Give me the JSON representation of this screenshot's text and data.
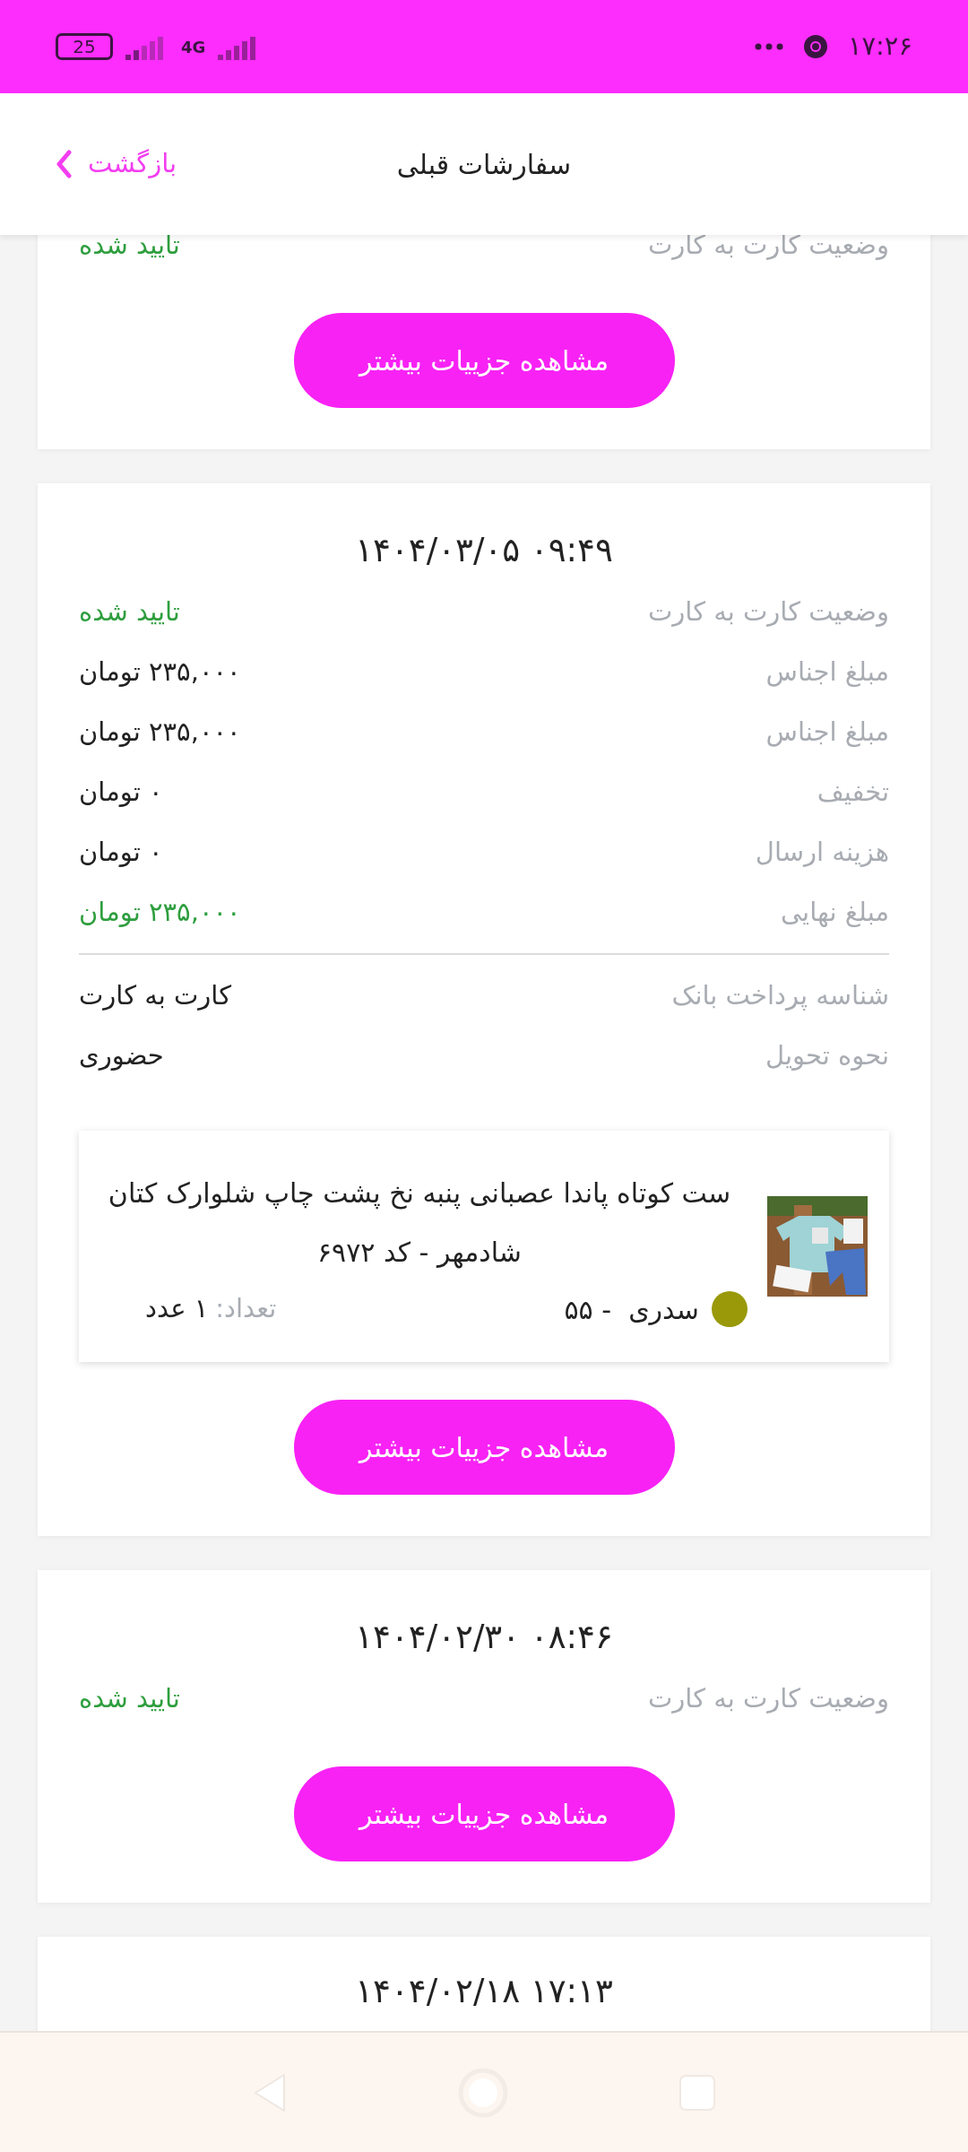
{
  "status_bar": {
    "battery": "25",
    "network": "4G",
    "time": "۱۷:۲۶"
  },
  "header": {
    "title": "سفارشات قبلی",
    "back_label": "بازگشت"
  },
  "orders": [
    {
      "rows": [
        {
          "label": "وضعیت کارت به کارت",
          "value": "تایید شده",
          "highlighted": true
        }
      ],
      "button": "مشاهده جزییات بیشتر"
    },
    {
      "datetime": "۱۴۰۴/۰۳/۰۵ ۰۹:۴۹",
      "rows": [
        {
          "label": "وضعیت کارت به کارت",
          "value": "تایید شده",
          "highlighted": true
        },
        {
          "label": "مبلغ اجناس",
          "value": "۲۳۵,۰۰۰ تومان",
          "highlighted": false
        },
        {
          "label": "مبلغ اجناس",
          "value": "۲۳۵,۰۰۰ تومان",
          "highlighted": false
        },
        {
          "label": "تخفیف",
          "value": "۰ تومان",
          "highlighted": false
        },
        {
          "label": "هزینه ارسال",
          "value": "۰ تومان",
          "highlighted": false
        },
        {
          "label": "مبلغ نهایی",
          "value": "۲۳۵,۰۰۰ تومان",
          "highlighted": true
        }
      ],
      "details": [
        {
          "label": "شناسه پرداخت بانک",
          "value": "کارت به کارت",
          "highlighted": false
        },
        {
          "label": "نحوه تحویل",
          "value": "حضوری",
          "highlighted": false
        }
      ],
      "product": {
        "title": "ست کوتاه پاندا عصبانی پنبه نخ پشت چاپ شلوارک کتان شادمهر - کد ۶۹۷۲",
        "color": "#99990a",
        "variant": "سدری  - ۵۵",
        "quantity_label": "تعداد:",
        "quantity": "۱ عدد"
      },
      "button": "مشاهده جزییات بیشتر"
    },
    {
      "datetime": "۱۴۰۴/۰۲/۳۰ ۰۸:۴۶",
      "rows": [
        {
          "label": "وضعیت کارت به کارت",
          "value": "تایید شده",
          "highlighted": true
        }
      ],
      "button": "مشاهده جزییات بیشتر"
    },
    {
      "datetime": "۱۴۰۴/۰۲/۱۸ ۱۷:۱۳"
    }
  ]
}
